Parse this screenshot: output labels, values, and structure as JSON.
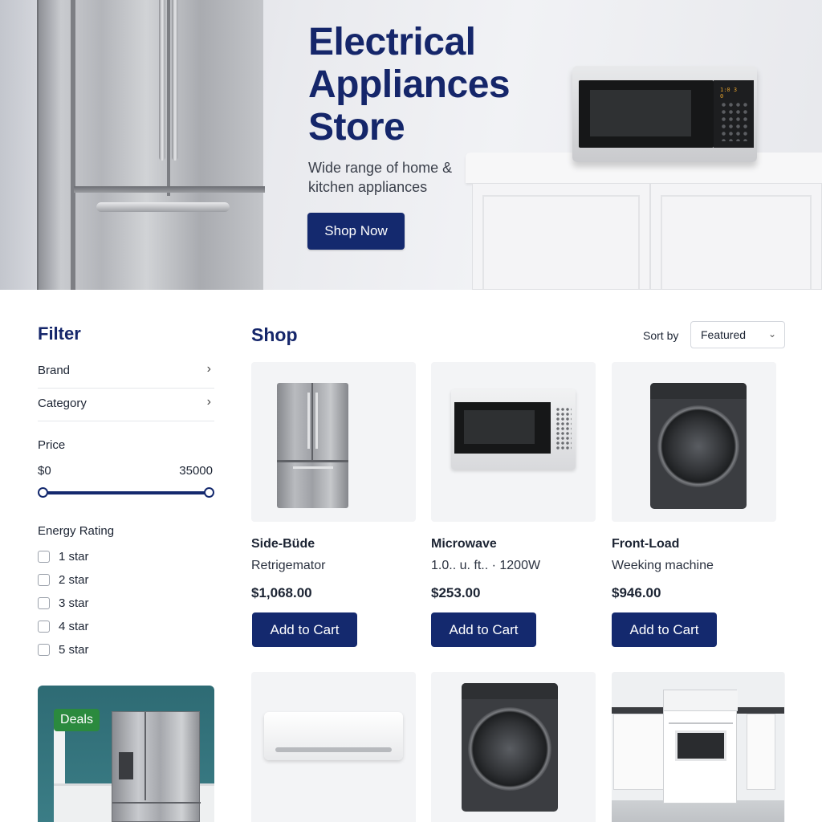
{
  "hero": {
    "title": "Electrical Appliances Store",
    "subtitle": "Wide range of home & kitchen appliances",
    "cta_label": "Shop Now"
  },
  "filter": {
    "title": "Filter",
    "rows": [
      {
        "label": "Brand",
        "icon": "chevron-right-icon"
      },
      {
        "label": "Category",
        "icon": "chevron-right-icon"
      }
    ],
    "price": {
      "label": "Price",
      "min_label": "$0",
      "max_label": "35000",
      "range_fraction": [
        0,
        1
      ]
    },
    "energy": {
      "title": "Energy Rating",
      "options": [
        "1 star",
        "2 star",
        "3 star",
        "4 star",
        "5 star"
      ]
    },
    "deals_badge": "Deals"
  },
  "shop": {
    "title": "Shop",
    "sort_label": "Sort by",
    "sort_value": "Featured",
    "products": [
      {
        "name": "Side-Büde",
        "desc": "Retrigemator",
        "price": "$1,068.00",
        "button": "Add to Cart"
      },
      {
        "name": "Microwave",
        "desc": "1.0.. u. ft.. ·  1200W",
        "price": "$253.00",
        "button": "Add to Cart"
      },
      {
        "name": "Front-Load",
        "desc": "Weeking machine",
        "price": "$946.00",
        "button": "Add to Cart"
      }
    ]
  },
  "theme": {
    "brand": "#14296e",
    "deals_green": "#2b8a3e"
  }
}
